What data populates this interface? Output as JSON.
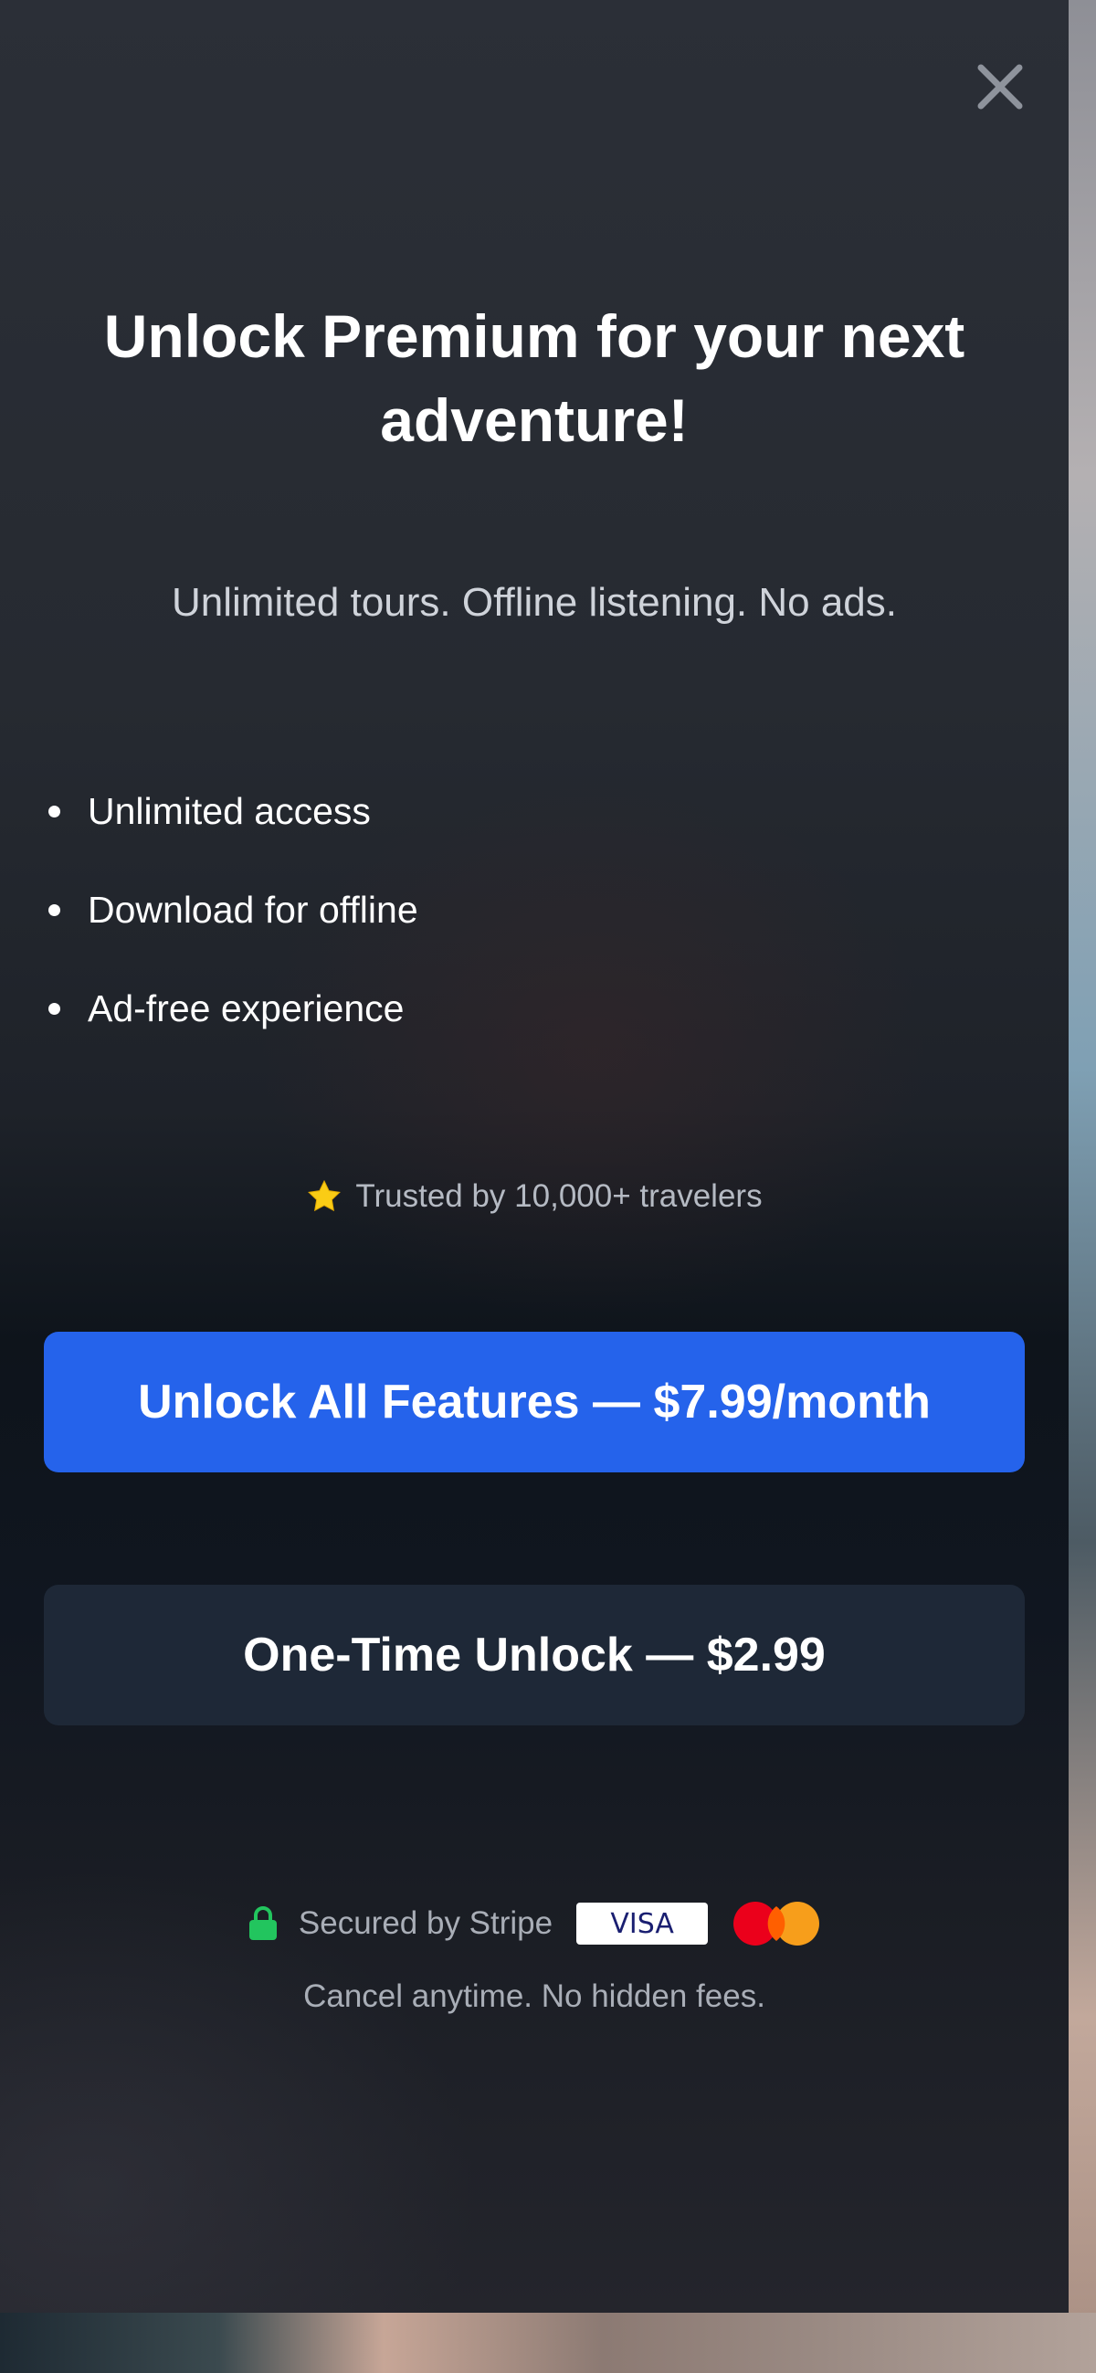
{
  "modal": {
    "title": "Unlock Premium for your next adventure!",
    "subtitle": "Unlimited tours. Offline listening. No ads.",
    "features": [
      {
        "label": "Unlimited access"
      },
      {
        "label": "Download for offline"
      },
      {
        "label": "Ad-free experience"
      }
    ],
    "trust_text": "Trusted by 10,000+ travelers",
    "trust_icon": "star-icon",
    "primary_button": "Unlock All Features — $7.99/month",
    "secondary_button": "One-Time Unlock — $2.99",
    "secured_text": "Secured by Stripe",
    "visa_label": "VISA",
    "cancel_text": "Cancel anytime. No hidden fees.",
    "close_icon": "close-icon"
  },
  "colors": {
    "primary": "#2563eb",
    "secondary": "#1e2837",
    "lock": "#22c55e",
    "star": "#facc15"
  }
}
